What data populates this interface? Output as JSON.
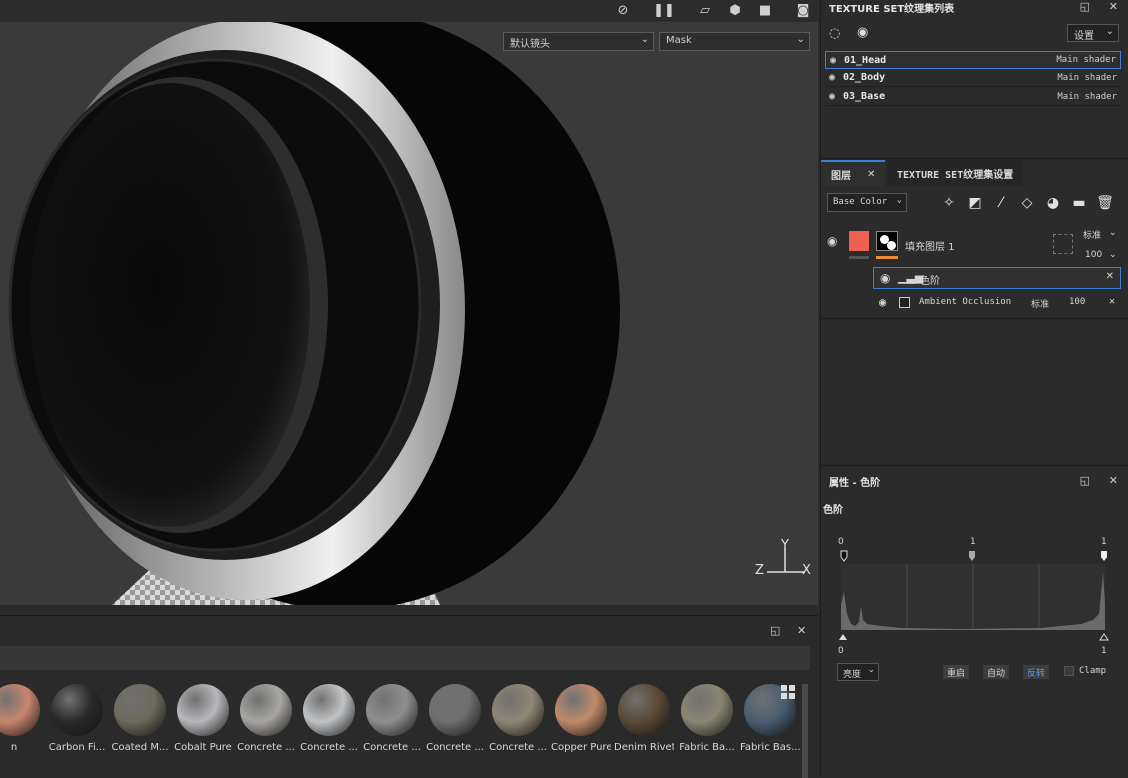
{
  "viewport": {
    "camera_select": "默认镜头",
    "channel_select": "Mask",
    "axis_labels": {
      "y": "Y",
      "z": "Z",
      "x": "X"
    }
  },
  "shelf": {
    "materials": [
      {
        "label": "n",
        "color": "#c9856f"
      },
      {
        "label": "Carbon Fi...",
        "color": "#2a2a2a"
      },
      {
        "label": "Coated M...",
        "color": "#6e6a5c"
      },
      {
        "label": "Cobalt Pure",
        "color": "#b8b8bc"
      },
      {
        "label": "Concrete ...",
        "color": "#a8a6a2"
      },
      {
        "label": "Concrete ...",
        "color": "#c0c2c4"
      },
      {
        "label": "Concrete ...",
        "color": "#8f8f8f"
      },
      {
        "label": "Concrete ...",
        "color": "#6f6f6f"
      },
      {
        "label": "Concrete ...",
        "color": "#8f8676"
      },
      {
        "label": "Copper Pure",
        "color": "#c08a6a"
      },
      {
        "label": "Denim Rivet",
        "color": "#5a4a36"
      },
      {
        "label": "Fabric Ba...",
        "color": "#8a8672"
      },
      {
        "label": "Fabric Bas...",
        "color": "#4a5e70"
      }
    ]
  },
  "texture_sets": {
    "title": "TEXTURE SET纹理集列表",
    "settings_label": "设置",
    "items": [
      {
        "name": "01_Head",
        "shader": "Main shader"
      },
      {
        "name": "02_Body",
        "shader": "Main shader"
      },
      {
        "name": "03_Base",
        "shader": "Main shader"
      }
    ]
  },
  "layers": {
    "tab_layers": "图层",
    "tab_settings": "TEXTURE SET纹理集设置",
    "channel": "Base Color",
    "fill_layer": {
      "name": "填充图层 1",
      "blend": "标准",
      "opacity": "100"
    },
    "levels": {
      "name": "色阶"
    },
    "ao": {
      "name": "Ambient Occlusion",
      "blend": "标准",
      "opacity": "100"
    }
  },
  "properties": {
    "title": "属性 - 色阶",
    "section": "色阶",
    "input_low": "0",
    "input_mid": "1",
    "input_high": "1",
    "output_low": "0",
    "output_high": "1",
    "mode": "亮度",
    "btn_reset": "重启",
    "btn_auto": "自动",
    "btn_invert": "反转",
    "clamp_label": "Clamp"
  }
}
